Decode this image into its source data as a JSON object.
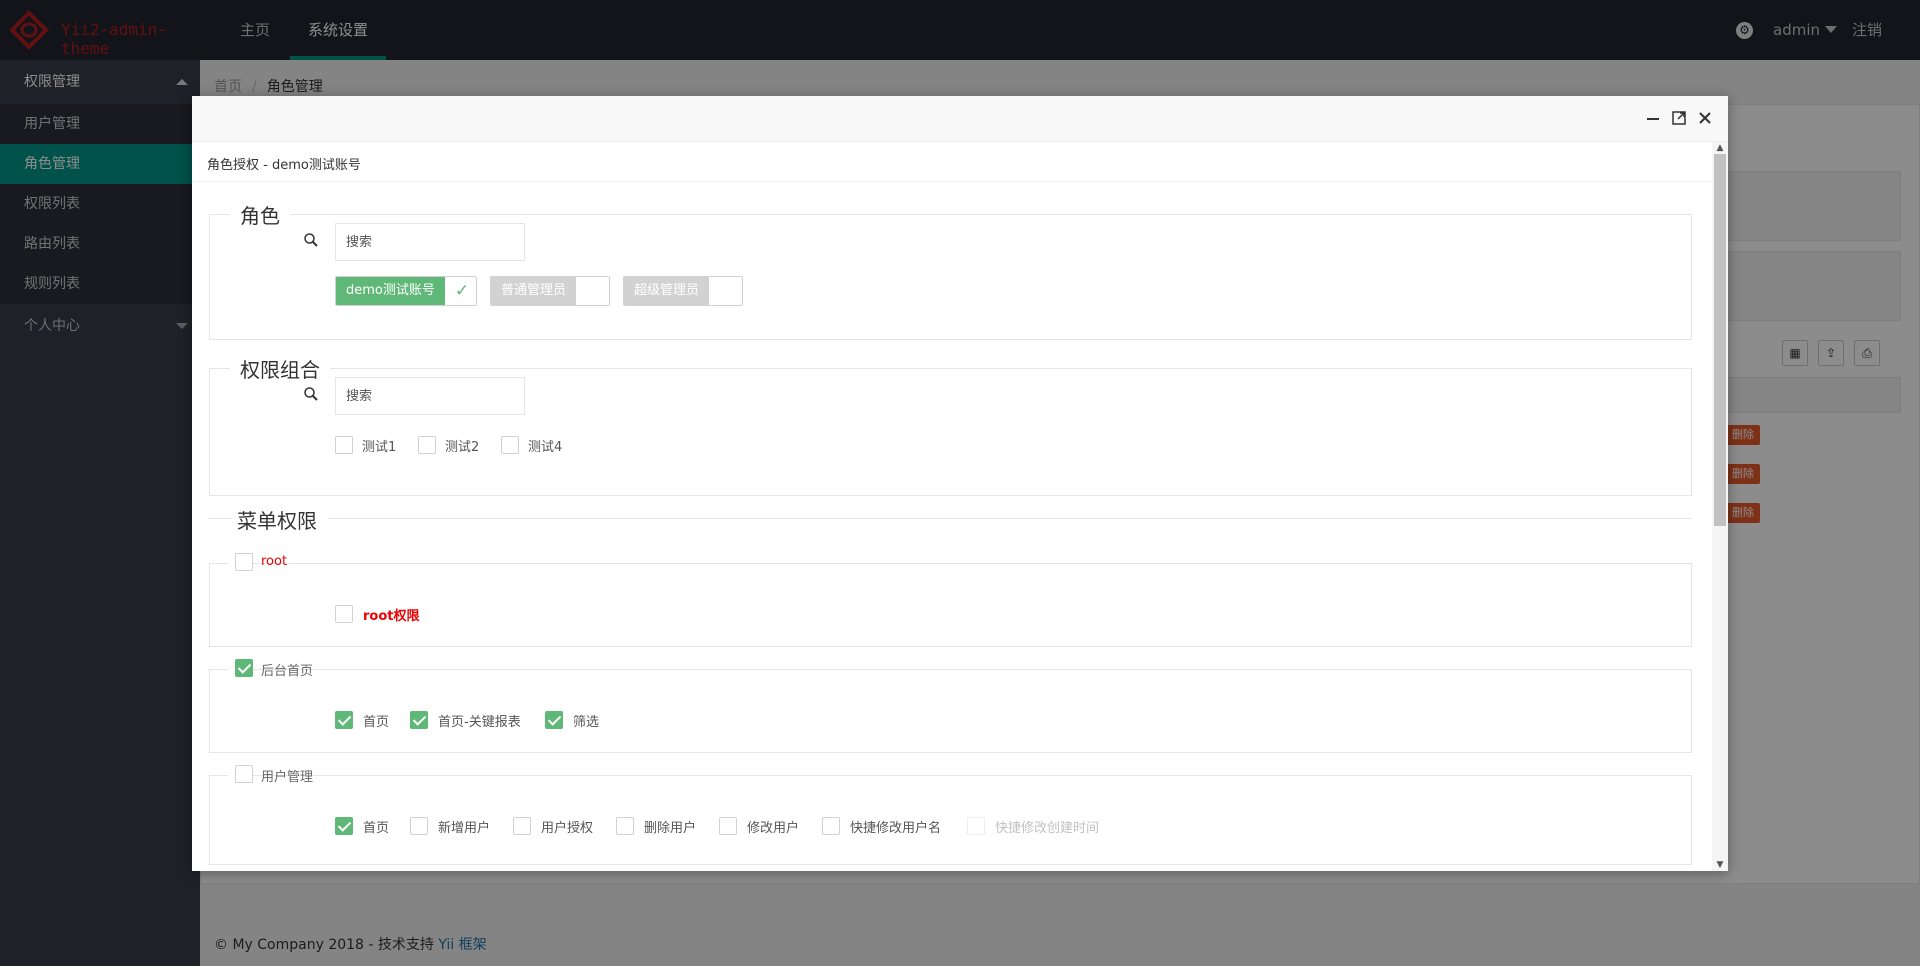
{
  "header": {
    "brand": "Yii2-admin-theme",
    "nav": [
      {
        "label": "主页"
      },
      {
        "label": "系统设置"
      }
    ],
    "user": "admin",
    "logout": "注销"
  },
  "sidebar": {
    "groups": [
      {
        "label": "权限管理",
        "items": [
          {
            "label": "用户管理"
          },
          {
            "label": "角色管理"
          },
          {
            "label": "权限列表"
          },
          {
            "label": "路由列表"
          },
          {
            "label": "规则列表"
          }
        ]
      },
      {
        "label": "个人中心"
      }
    ]
  },
  "breadcrumb": {
    "home": "首页",
    "sep": "/",
    "current": "角色管理"
  },
  "table": {
    "delete_label": "删除"
  },
  "footer": {
    "text": "© My Company 2018 - 技术支持 ",
    "link": "Yii 框架"
  },
  "modal": {
    "title": "角色授权 - demo测试账号",
    "roles": {
      "legend": "角色",
      "search_placeholder": "搜索",
      "tags": [
        {
          "label": "demo测试账号",
          "checked": true
        },
        {
          "label": "普通管理员",
          "checked": false
        },
        {
          "label": "超级管理员",
          "checked": false
        }
      ]
    },
    "perm_groups": {
      "legend": "权限组合",
      "search_placeholder": "搜索",
      "items": [
        {
          "label": "测试1"
        },
        {
          "label": "测试2"
        },
        {
          "label": "测试4"
        }
      ]
    },
    "menu_perms": {
      "title": "菜单权限",
      "sections": [
        {
          "label": "root",
          "checked": false,
          "items": [
            {
              "label": "root权限",
              "checked": false
            }
          ]
        },
        {
          "label": "后台首页",
          "checked": true,
          "items": [
            {
              "label": "首页",
              "checked": true
            },
            {
              "label": "首页-关键报表",
              "checked": true
            },
            {
              "label": "筛选",
              "checked": true
            }
          ]
        },
        {
          "label": "用户管理",
          "checked": false,
          "items": [
            {
              "label": "首页",
              "checked": true
            },
            {
              "label": "新增用户",
              "checked": false
            },
            {
              "label": "用户授权",
              "checked": false
            },
            {
              "label": "删除用户",
              "checked": false
            },
            {
              "label": "修改用户",
              "checked": false
            },
            {
              "label": "快捷修改用户名",
              "checked": false
            },
            {
              "label": "快捷修改创建时间",
              "checked": false,
              "disabled": true
            }
          ]
        }
      ]
    }
  }
}
